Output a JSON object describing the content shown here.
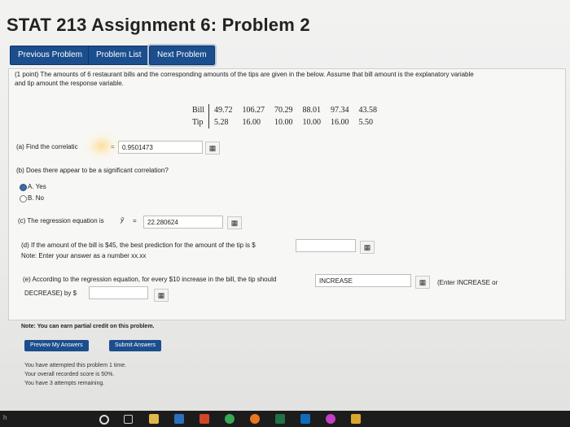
{
  "title": "STAT 213 Assignment 6: Problem 2",
  "nav": {
    "previous": "Previous Problem",
    "list": "Problem List",
    "next": "Next Problem"
  },
  "intro_line1": "(1 point) The amounts of 6 restaurant bills and the corresponding amounts of the tips are given in the below. Assume that bill amount is the explanatory variable",
  "intro_line2": "and tip amount the response variable.",
  "table": {
    "rows": [
      {
        "label": "Bill",
        "values": [
          "49.72",
          "106.27",
          "70.29",
          "88.01",
          "97.34",
          "43.58"
        ]
      },
      {
        "label": "Tip",
        "values": [
          "5.28",
          "16.00",
          "10.00",
          "10.00",
          "16.00",
          "5.50"
        ]
      }
    ]
  },
  "part_a": {
    "label": "(a) Find the correlatic",
    "equals": "=",
    "value": "0.9501473"
  },
  "part_b": {
    "label": "(b) Does there appear to be a significant correlation?",
    "option_a": "A. Yes",
    "option_b": "B. No",
    "selected": "A"
  },
  "part_c": {
    "label": "(c) The regression equation is",
    "yhat": "ŷ",
    "equals": "=",
    "value": "22.280624"
  },
  "part_d": {
    "label": "(d) If the amount of the bill is $45, the best prediction for the amount of the tip is $",
    "note": "Note: Enter your answer as a number xx.xx",
    "value": ""
  },
  "part_e": {
    "label": "(e) According to the regression equation, for every $10 increase in the bill, the tip should",
    "value": "INCREASE",
    "hint": "(Enter INCREASE or",
    "label2": "DECREASE) by $",
    "value2": ""
  },
  "footer_note": "Note: You can earn partial credit on this problem.",
  "buttons": {
    "preview": "Preview My Answers",
    "submit": "Submit Answers"
  },
  "status": {
    "attempted": "You have attempted this problem 1 time.",
    "score": "Your overall recorded score is 50%.",
    "remaining": "You have 3 attempts remaining."
  },
  "taskbar": {
    "label": "h",
    "icons": [
      "search-icon",
      "task-view-icon",
      "file-explorer-icon",
      "store-icon",
      "office-icon",
      "chrome-icon",
      "firefox-icon",
      "excel-icon",
      "mail-icon",
      "itunes-icon",
      "generic-app-icon"
    ]
  },
  "colors": {
    "button_blue": "#1b4e8d"
  }
}
